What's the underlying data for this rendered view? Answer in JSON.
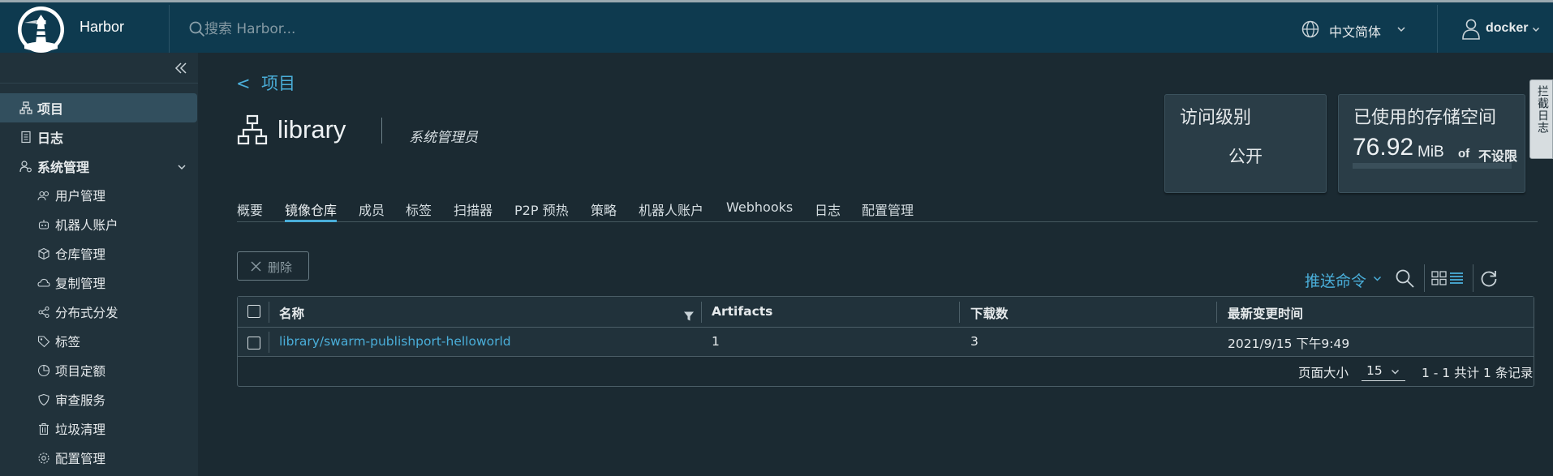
{
  "header": {
    "brand": "Harbor",
    "search_placeholder": "搜索 Harbor...",
    "language": "中文简体",
    "user": "docker"
  },
  "sidebar": {
    "items": [
      {
        "label": "项目",
        "icon": "project-icon"
      },
      {
        "label": "日志",
        "icon": "log-icon"
      },
      {
        "label": "系统管理",
        "icon": "admin-icon"
      },
      {
        "label": "用户管理",
        "icon": "users-icon"
      },
      {
        "label": "机器人账户",
        "icon": "robot-icon"
      },
      {
        "label": "仓库管理",
        "icon": "registry-icon"
      },
      {
        "label": "复制管理",
        "icon": "replication-icon"
      },
      {
        "label": "分布式分发",
        "icon": "distribution-icon"
      },
      {
        "label": "标签",
        "icon": "tag-icon"
      },
      {
        "label": "项目定额",
        "icon": "quota-icon"
      },
      {
        "label": "审查服务",
        "icon": "shield-icon"
      },
      {
        "label": "垃圾清理",
        "icon": "trash-icon"
      },
      {
        "label": "配置管理",
        "icon": "gear-icon"
      }
    ]
  },
  "main": {
    "back_label": "项目",
    "project_name": "library",
    "role": "系统管理员",
    "access_card": {
      "title": "访问级别",
      "value": "公开"
    },
    "storage_card": {
      "title": "已使用的存储空间",
      "value": "76.92",
      "unit": "MiB",
      "of": "of",
      "limit": "不设限",
      "usage_fraction": 0
    },
    "side_tab": "拦截日志",
    "tabs": [
      "概要",
      "镜像仓库",
      "成员",
      "标签",
      "扫描器",
      "P2P 预热",
      "策略",
      "机器人账户",
      "Webhooks",
      "日志",
      "配置管理"
    ],
    "active_tab": "镜像仓库",
    "delete_label": "删除",
    "push_command_label": "推送命令",
    "table": {
      "columns": [
        "名称",
        "Artifacts",
        "下载数",
        "最新变更时间"
      ],
      "rows": [
        {
          "name": "library/swarm-publishport-helloworld",
          "artifacts": "1",
          "downloads": "3",
          "updated": "2021/9/15 下午9:49"
        }
      ],
      "page_size_label": "页面大小",
      "page_size": "15",
      "page_info": "1 - 1 共计 1 条记录"
    }
  },
  "colors": {
    "header_bg": "#0e3a4f",
    "sidebar_bg": "#21323b",
    "main_bg": "#1b2a32",
    "accent": "#4aaed9"
  }
}
